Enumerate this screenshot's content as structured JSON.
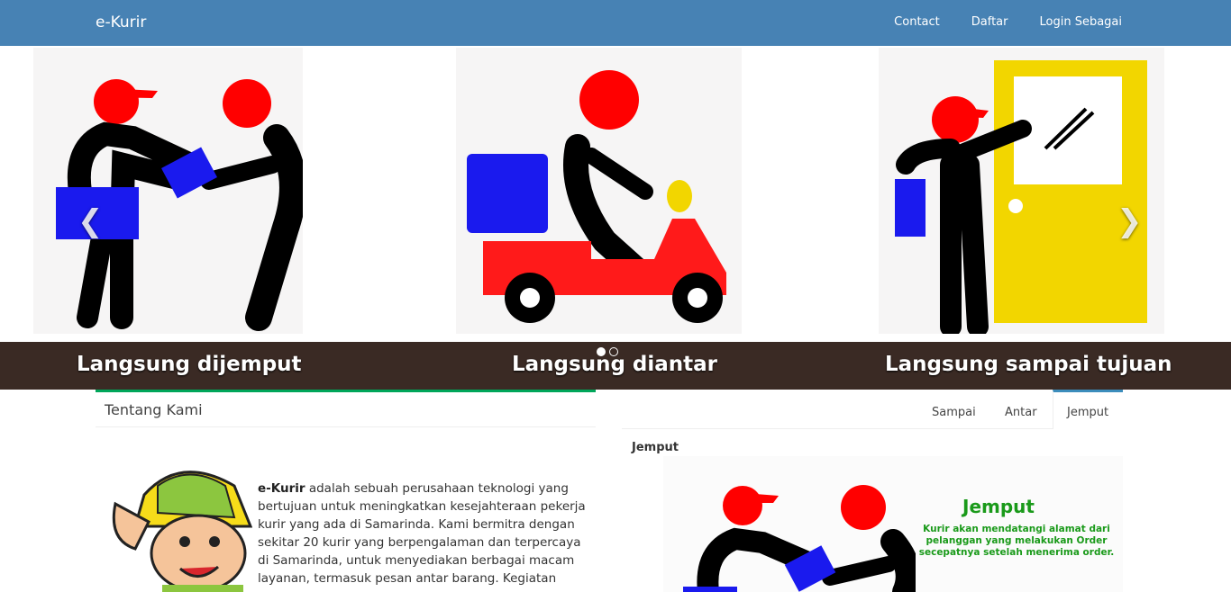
{
  "navbar": {
    "brand": "e-Kurir",
    "links": [
      "Contact",
      "Daftar",
      "Login Sebagai"
    ]
  },
  "carousel": {
    "captions": [
      "Langsung dijemput",
      "Langsung diantar",
      "Langsung sampai tujuan"
    ],
    "prev_icon": "chevron-left-icon",
    "next_icon": "chevron-right-icon",
    "indicator_count": 2,
    "active_indicator": 1
  },
  "about": {
    "title": "Tentang Kami",
    "brand_bold": "e-Kurir",
    "text": " adalah sebuah perusahaan teknologi yang bertujuan untuk meningkatkan kesejahteraan pekerja kurir yang ada di Samarinda. Kami bermitra dengan sekitar 20 kurir yang berpengalaman dan terpercaya di Samarinda, untuk menyediakan berbagai macam layanan, termasuk pesan antar barang. Kegiatan"
  },
  "service_tabs": {
    "tabs": [
      "Sampai",
      "Antar",
      "Jemput"
    ],
    "active": "Jemput",
    "heading": "Jemput",
    "card_title": "Jemput",
    "card_desc": "Kurir akan mendatangi alamat dari pelanggan yang melakukan Order secepatnya setelah menerima order."
  },
  "colors": {
    "navbar": "#4782b4",
    "about_accent": "#00a65a",
    "tab_accent": "#3c8dbc",
    "caption_bar": "#3a2a24",
    "courier_red": "#ff0000",
    "parcel_blue": "#1a1aee",
    "door_yellow": "#f2d600"
  }
}
